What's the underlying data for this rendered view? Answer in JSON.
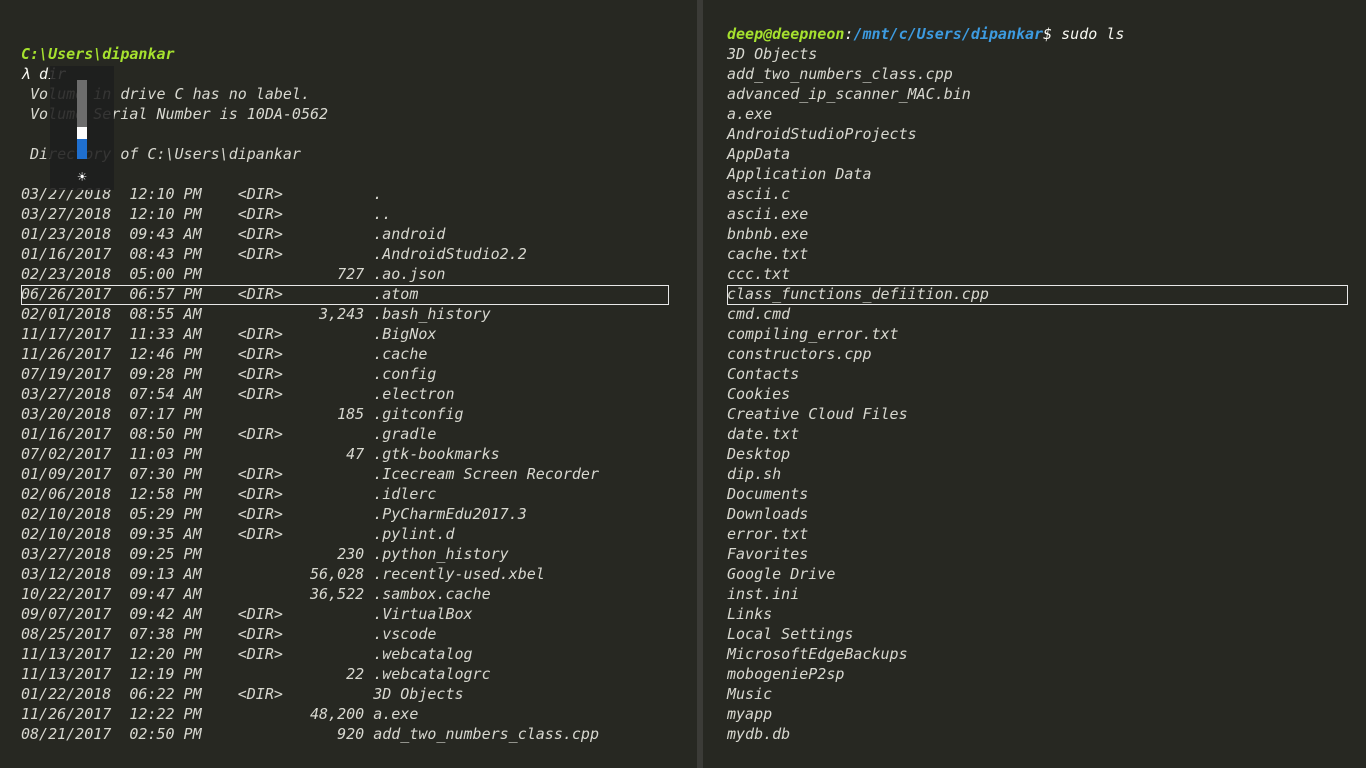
{
  "left_terminal": {
    "prompt_path": "C:\\Users\\dipankar",
    "command": "λ dir",
    "header_lines": [
      " Volume in drive C has no label.",
      " Volume Serial Number is 10DA-0562",
      "",
      " Directory of C:\\Users\\dipankar"
    ],
    "entries": [
      "03/27/2018  12:10 PM    <DIR>          .",
      "03/27/2018  12:10 PM    <DIR>          ..",
      "01/23/2018  09:43 AM    <DIR>          .android",
      "01/16/2017  08:43 PM    <DIR>          .AndroidStudio2.2",
      "02/23/2018  05:00 PM               727 .ao.json",
      "06/26/2017  06:57 PM    <DIR>          .atom",
      "02/01/2018  08:55 AM             3,243 .bash_history",
      "11/17/2017  11:33 AM    <DIR>          .BigNox",
      "11/26/2017  12:46 PM    <DIR>          .cache",
      "07/19/2017  09:28 PM    <DIR>          .config",
      "03/27/2018  07:54 AM    <DIR>          .electron",
      "03/20/2018  07:17 PM               185 .gitconfig",
      "01/16/2017  08:50 PM    <DIR>          .gradle",
      "07/02/2017  11:03 PM                47 .gtk-bookmarks",
      "01/09/2017  07:30 PM    <DIR>          .Icecream Screen Recorder",
      "02/06/2018  12:58 PM    <DIR>          .idlerc",
      "02/10/2018  05:29 PM    <DIR>          .PyCharmEdu2017.3",
      "02/10/2018  09:35 AM    <DIR>          .pylint.d",
      "03/27/2018  09:25 PM               230 .python_history",
      "03/12/2018  09:13 AM            56,028 .recently-used.xbel",
      "10/22/2017  09:47 AM            36,522 .sambox.cache",
      "09/07/2017  09:42 AM    <DIR>          .VirtualBox",
      "08/25/2017  07:38 PM    <DIR>          .vscode",
      "11/13/2017  12:20 PM    <DIR>          .webcatalog",
      "11/13/2017  12:19 PM                22 .webcatalogrc",
      "01/22/2018  06:22 PM    <DIR>          3D Objects",
      "11/26/2017  12:22 PM            48,200 a.exe",
      "08/21/2017  02:50 PM               920 add_two_numbers_class.cpp"
    ],
    "selected_entry_index": 5
  },
  "right_terminal": {
    "prompt_user": "deep@deepneon",
    "prompt_sep": ":",
    "prompt_path": "/mnt/c/Users/dipankar",
    "prompt_symbol": "$",
    "command": " sudo ls",
    "entries": [
      "3D Objects",
      "add_two_numbers_class.cpp",
      "advanced_ip_scanner_MAC.bin",
      "a.exe",
      "AndroidStudioProjects",
      "AppData",
      "Application Data",
      "ascii.c",
      "ascii.exe",
      "bnbnb.exe",
      "cache.txt",
      "ccc.txt",
      "class_functions_defiition.cpp",
      "cmd.cmd",
      "compiling_error.txt",
      "constructors.cpp",
      "Contacts",
      "Cookies",
      "Creative Cloud Files",
      "date.txt",
      "Desktop",
      "dip.sh",
      "Documents",
      "Downloads",
      "error.txt",
      "Favorites",
      "Google Drive",
      "inst.ini",
      "Links",
      "Local Settings",
      "MicrosoftEdgeBackups",
      "mobogenieP2sp",
      "Music",
      "myapp",
      "mydb.db"
    ],
    "selected_entry_index": 12
  },
  "osd": {
    "type": "brightness",
    "icon": "brightness-icon",
    "level": 0.25
  },
  "colors": {
    "background": "#272822",
    "text": "#d8d8d0",
    "prompt_green": "#a6e22e",
    "prompt_blue": "#3d9be0",
    "osd_fill": "#1f6fcf"
  }
}
